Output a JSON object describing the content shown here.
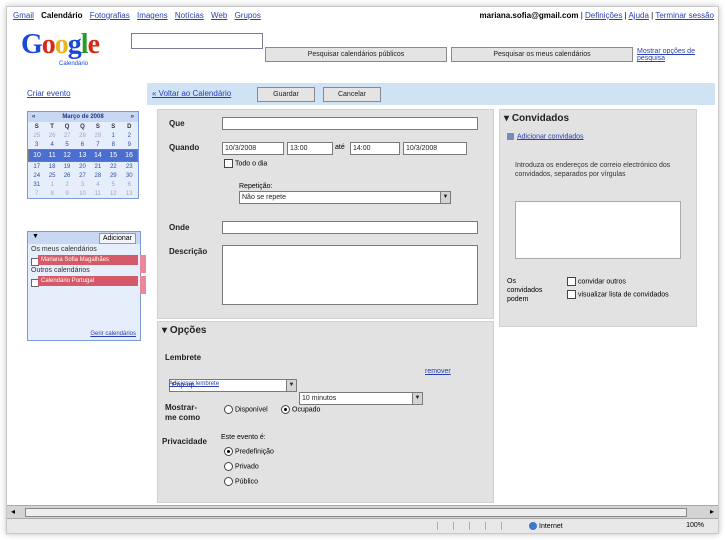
{
  "nav": {
    "items": [
      "Gmail",
      "Calendário",
      "Fotografias",
      "Imagens",
      "Notícias",
      "Web",
      "Grupos"
    ],
    "active_index": 1
  },
  "account": {
    "email": "mariana.sofia@gmail.com",
    "links": [
      "Definições",
      "Ajuda",
      "Terminar sessão"
    ]
  },
  "logo": {
    "text": "Google",
    "subtitle": "Calendário"
  },
  "search": {
    "value": "",
    "button_public": "Pesquisar calendários públicos",
    "button_mine": "Pesquisar os meus calendários",
    "show_options": "Mostrar opções de pesquisa"
  },
  "sidebar": {
    "create_event": "Criar evento",
    "month_title": "Março de 2008",
    "nav_prev": "«",
    "nav_next": "»",
    "weekdays": [
      "S",
      "T",
      "Q",
      "Q",
      "S",
      "S",
      "D"
    ],
    "weeks": [
      [
        "25",
        "26",
        "27",
        "28",
        "29",
        "1",
        "2"
      ],
      [
        "3",
        "4",
        "5",
        "6",
        "7",
        "8",
        "9"
      ],
      [
        "10",
        "11",
        "12",
        "13",
        "14",
        "15",
        "16"
      ],
      [
        "17",
        "18",
        "19",
        "20",
        "21",
        "22",
        "23"
      ],
      [
        "24",
        "25",
        "26",
        "27",
        "28",
        "29",
        "30"
      ],
      [
        "31",
        "1",
        "2",
        "3",
        "4",
        "5",
        "6"
      ],
      [
        "7",
        "8",
        "9",
        "10",
        "11",
        "12",
        "13"
      ]
    ],
    "my_cal_add": "Adicionar",
    "my_calendars_title": "Os meus calendários",
    "my_calendar_item": "Mariana Sofia Magalhães",
    "other_calendars_title": "Outros calendários",
    "other_calendar_item": "Calendário Portugal",
    "manage_link": "Gerir calendários"
  },
  "toolbar": {
    "back": "« Voltar ao Calendário",
    "save": "Guardar",
    "cancel": "Cancelar"
  },
  "event": {
    "what_label": "Que",
    "what_value": "",
    "when_label": "Quando",
    "start_date": "10/3/2008",
    "start_time": "13:00",
    "until": "até",
    "end_time": "14:00",
    "end_date": "10/3/2008",
    "all_day": "Todo o dia",
    "repeat_label": "Repetição:",
    "repeat_value": "Não se repete",
    "where_label": "Onde",
    "where_value": "",
    "description_label": "Descrição",
    "description_value": ""
  },
  "options": {
    "title": "Opções",
    "reminder_label": "Lembrete",
    "reminder_type": "Pop-up",
    "reminder_time": "10 minutos",
    "reminder_remove": "remover",
    "add_reminder": "Adicionar lembrete",
    "show_as_label": "Mostrar-me como",
    "available": "Disponível",
    "busy": "Ocupado",
    "privacy_label": "Privacidade",
    "privacy_question": "Este evento é:",
    "privacy_default": "Predefinição",
    "privacy_private": "Privado",
    "privacy_public": "Público"
  },
  "guests": {
    "title": "Convidados",
    "add_link": "Adicionar convidados",
    "instructions": "Introduza os endereços de correio electrónico dos convidados, separados por vírgulas",
    "can_label": "Os convidados podem",
    "invite_others": "convidar outros",
    "see_list": "visualizar lista de convidados"
  },
  "status": {
    "zone": "Internet",
    "zoom": "100%"
  }
}
